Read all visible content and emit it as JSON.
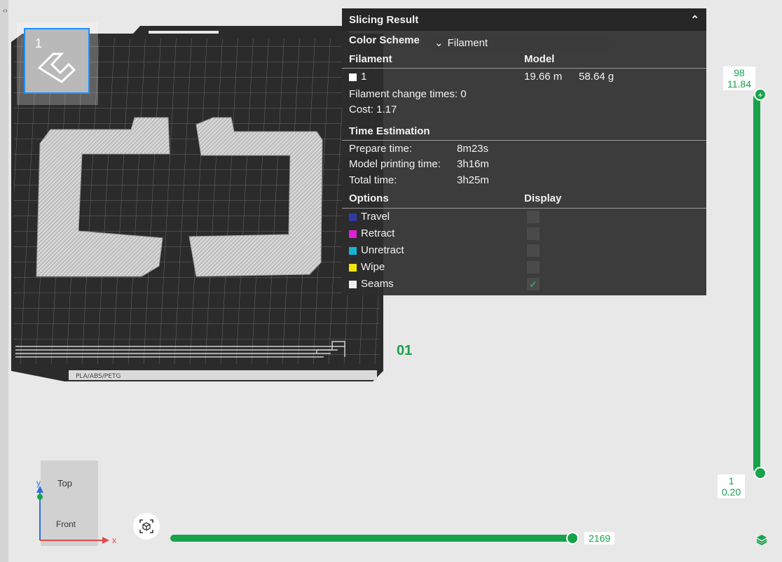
{
  "plate": {
    "thumb_number": "1",
    "plate_number": "01",
    "plate_text": "PLA/ABS/PETG"
  },
  "panel": {
    "title": "Slicing Result",
    "color_scheme_label": "Color Scheme",
    "color_scheme_value": "Filament",
    "filament_header": "Filament",
    "model_header": "Model",
    "filament_index": "1",
    "filament_length": "19.66 m",
    "filament_weight": "58.64 g",
    "change_times": "Filament change times: 0",
    "cost": "Cost: 1.17",
    "time_header": "Time Estimation",
    "prepare_label": "Prepare time:",
    "prepare_value": "8m23s",
    "model_label": "Model printing time:",
    "model_value": "3h16m",
    "total_label": "Total time:",
    "total_value": "3h25m",
    "options_header": "Options",
    "display_header": "Display",
    "options": [
      {
        "label": "Travel",
        "color": "#2e3aa6",
        "checked": false
      },
      {
        "label": "Retract",
        "color": "#e51fd8",
        "checked": false
      },
      {
        "label": "Unretract",
        "color": "#17b3d6",
        "checked": false
      },
      {
        "label": "Wipe",
        "color": "#f2e50c",
        "checked": false
      },
      {
        "label": "Seams",
        "color": "#f0f0f0",
        "checked": true
      }
    ]
  },
  "layer_slider": {
    "top_layer": "98",
    "top_height": "11.84",
    "bottom_layer": "1",
    "bottom_height": "0.20"
  },
  "move_slider": {
    "value": "2169"
  },
  "nav_cube": {
    "top": "Top",
    "front": "Front",
    "axis_y": "y",
    "axis_x": "x"
  },
  "colors": {
    "accent": "#16a34a",
    "panel_bg": "#2d2d2d",
    "thumb_border": "#1f8fff"
  }
}
